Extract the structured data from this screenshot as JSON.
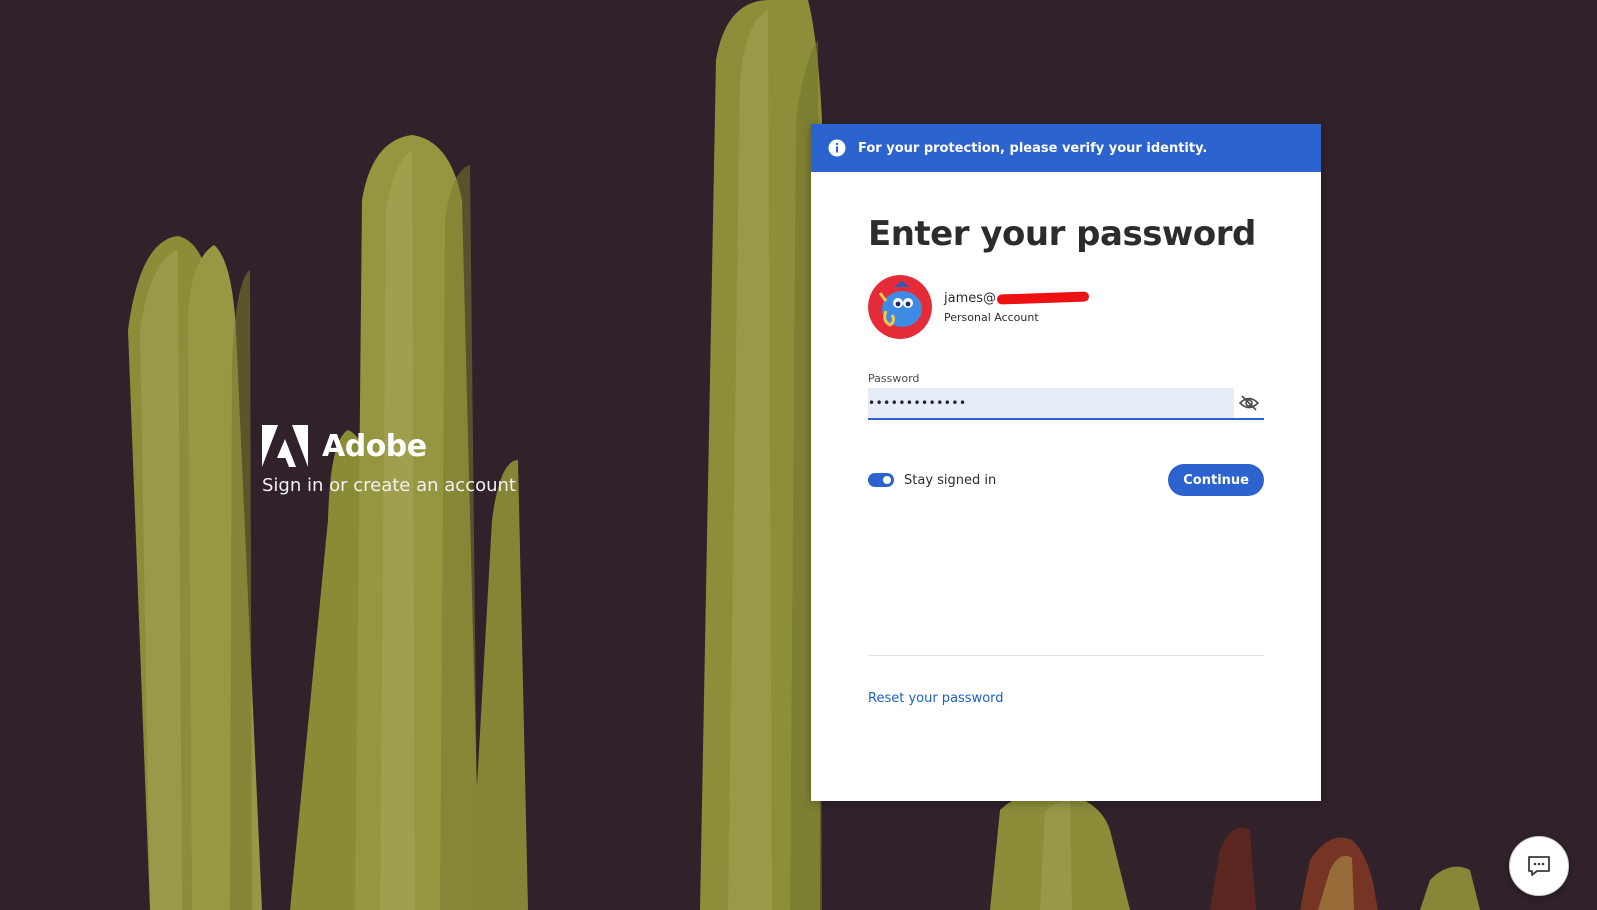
{
  "brand": {
    "name": "Adobe",
    "tagline": "Sign in or create an account"
  },
  "banner": {
    "message": "For your protection, please verify your identity.",
    "icon": "info-icon"
  },
  "card": {
    "title": "Enter your password",
    "account": {
      "email_visible": "james@",
      "email_redacted": true,
      "type": "Personal Account",
      "avatar": "avatar-illustration"
    },
    "password": {
      "label": "Password",
      "value": "•••••••••••••",
      "toggle_icon": "eye-slash-icon"
    },
    "stay_signed_in": {
      "label": "Stay signed in",
      "checked": true
    },
    "continue_label": "Continue",
    "reset_link": "Reset your password"
  },
  "chat": {
    "icon": "chat-icon"
  },
  "colors": {
    "accent": "#2d63cf",
    "background": "#32232e",
    "link": "#1d5fc7"
  }
}
